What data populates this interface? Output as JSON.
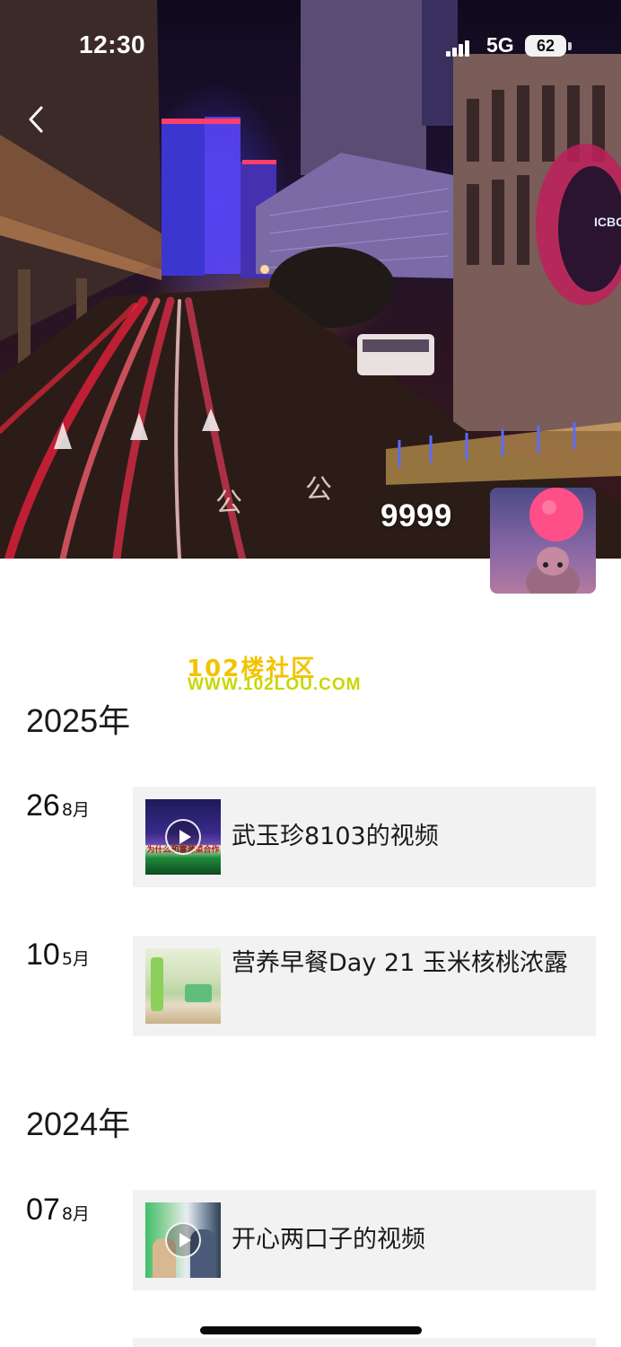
{
  "status_bar": {
    "time": "12:30",
    "network": "5G",
    "battery": "62"
  },
  "profile": {
    "username": "9999"
  },
  "cover_signs": {
    "sign_bank": "ICBC"
  },
  "watermark": {
    "line1": "102楼社区",
    "line2": "WWW.102LOU.COM"
  },
  "timeline": [
    {
      "year": "2025年",
      "entries": [
        {
          "day": "26",
          "month": "8月",
          "title": "武玉珍8103的视频",
          "thumb_caption": "为什么和富源菜合作",
          "has_play": true
        },
        {
          "day": "10",
          "month": "5月",
          "title": "营养早餐Day 21 玉米核桃浓露",
          "has_play": false
        }
      ]
    },
    {
      "year": "2024年",
      "entries": [
        {
          "day": "07",
          "month": "8月",
          "title": "开心两口子的视频",
          "has_play": true
        }
      ]
    }
  ],
  "colors": {
    "card_bg": "#f2f2f2",
    "watermark_yellow": "#f2c300",
    "watermark_green": "#c8d600"
  }
}
